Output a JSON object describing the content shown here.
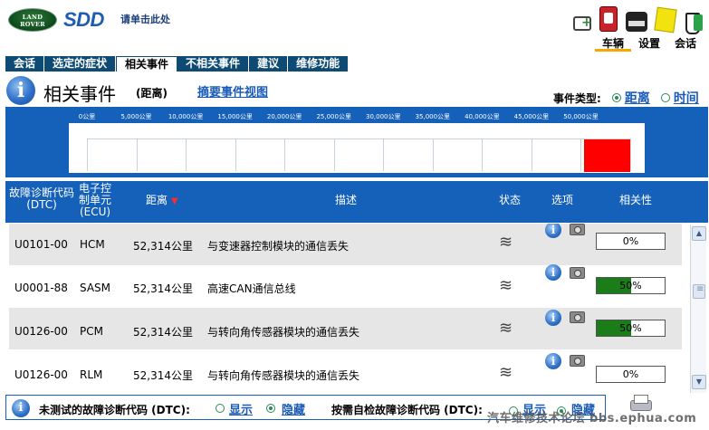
{
  "header": {
    "logo_text": "LAND ROVER",
    "app_name": "SDD",
    "click_here": "请单击此处",
    "top_tabs": [
      {
        "label": "车辆",
        "active": true
      },
      {
        "label": "设置",
        "active": false
      },
      {
        "label": "会话",
        "active": false
      }
    ],
    "toolbar_icons": [
      "toolbox-plus-icon",
      "red-device-icon",
      "vehicle-interface-icon",
      "note-icon",
      "battery-flask-icon"
    ]
  },
  "nav": {
    "items": [
      {
        "label": "会话",
        "active": false
      },
      {
        "label": "选定的症状",
        "active": false
      },
      {
        "label": "相关事件",
        "active": true
      },
      {
        "label": "不相关事件",
        "active": false
      },
      {
        "label": "建议",
        "active": false
      },
      {
        "label": "维修功能",
        "active": false
      }
    ]
  },
  "page": {
    "title": "相关事件",
    "subtitle": "(距离)",
    "summary_link": "摘要事件视图",
    "event_type_label": "事件类型:",
    "event_type_options": [
      {
        "label": "距离",
        "selected": true
      },
      {
        "label": "时间",
        "selected": false
      }
    ]
  },
  "timeline": {
    "ticks": [
      "0公里",
      "5,000公里",
      "10,000公里",
      "15,000公里",
      "20,000公里",
      "25,000公里",
      "30,000公里",
      "35,000公里",
      "40,000公里",
      "45,000公里",
      "50,000公里"
    ],
    "tick_values": [
      0,
      5000,
      10000,
      15000,
      20000,
      25000,
      30000,
      35000,
      40000,
      45000,
      50000
    ],
    "range_max": 55000,
    "event_bar": {
      "start": 50000,
      "end": 55000,
      "color": "#ff0000"
    }
  },
  "table": {
    "headers": {
      "dtc": "故障诊断代码 (DTC)",
      "ecu": "电子控制单元 (ECU)",
      "distance": "距离",
      "description": "描述",
      "status": "状态",
      "options": "选项",
      "relevance": "相关性"
    },
    "rows": [
      {
        "dtc": "U0101-00",
        "ecu": "HCM",
        "distance": "52,314公里",
        "description": "与变速器控制模块的通信丢失",
        "relevance_text": "0%",
        "relevance": 0
      },
      {
        "dtc": "U0001-88",
        "ecu": "SASM",
        "distance": "52,314公里",
        "description": "高速CAN通信总线",
        "relevance_text": "50%",
        "relevance": 50
      },
      {
        "dtc": "U0126-00",
        "ecu": "PCM",
        "distance": "52,314公里",
        "description": "与转向角传感器模块的通信丢失",
        "relevance_text": "50%",
        "relevance": 50
      },
      {
        "dtc": "U0126-00",
        "ecu": "RLM",
        "distance": "52,314公里",
        "description": "与转向角传感器模块的通信丢失",
        "relevance_text": "0%",
        "relevance": 0
      }
    ]
  },
  "footer": {
    "untested_label": "未测试的故障诊断代码 (DTC):",
    "show": "显示",
    "hide": "隐藏",
    "self_test_label": "按需自检故障诊断代码 (DTC):",
    "show2": "显示",
    "hide2": "隐藏"
  },
  "watermark": "汽车维修技术论坛 bbs.ephua.com"
}
